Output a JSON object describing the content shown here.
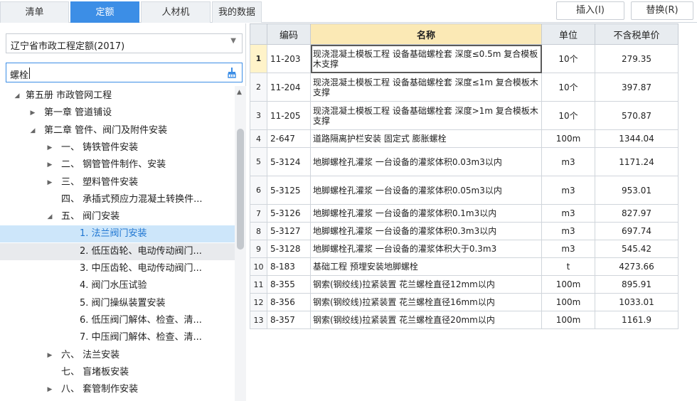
{
  "tabs": [
    "清单",
    "定额",
    "人材机",
    "我的数据"
  ],
  "active_tab": 1,
  "buttons": {
    "insert": "插入(I)",
    "replace": "替换(R)"
  },
  "library_select": {
    "value": "辽宁省市政工程定额(2017)"
  },
  "search": {
    "value": "螺栓"
  },
  "tree": [
    {
      "toggle": "◢",
      "label": "第五册 市政管网工程"
    },
    {
      "toggle": "▶",
      "label": "第一章 管道铺设"
    },
    {
      "toggle": "◢",
      "label": "第二章 管件、阀门及附件安装"
    },
    {
      "toggle": "▶",
      "label": "一、 铸铁管件安装"
    },
    {
      "toggle": "▶",
      "label": "二、 钢管管件制作、安装"
    },
    {
      "toggle": "▶",
      "label": "三、 塑料管件安装"
    },
    {
      "toggle": "",
      "label": "四、 承插式预应力混凝土转换件..."
    },
    {
      "toggle": "◢",
      "label": "五、 阀门安装"
    },
    {
      "toggle": "",
      "label": "1. 法兰阀门安装",
      "selected": true
    },
    {
      "toggle": "",
      "label": "2. 低压齿轮、电动传动阀门...",
      "hover": true
    },
    {
      "toggle": "",
      "label": "3. 中压齿轮、电动传动阀门..."
    },
    {
      "toggle": "",
      "label": "4. 阀门水压试验"
    },
    {
      "toggle": "",
      "label": "5. 阀门操纵装置安装"
    },
    {
      "toggle": "",
      "label": "6. 低压阀门解体、检查、清..."
    },
    {
      "toggle": "",
      "label": "7. 中压阀门解体、检查、清..."
    },
    {
      "toggle": "▶",
      "label": "六、 法兰安装"
    },
    {
      "toggle": "",
      "label": "七、 盲堵板安装"
    },
    {
      "toggle": "▶",
      "label": "八、 套管制作安装"
    }
  ],
  "table": {
    "columns": [
      "",
      "编码",
      "名称",
      "单位",
      "不含税单价"
    ],
    "rows": [
      {
        "no": "1",
        "code": "11-203",
        "name": "现浇混凝土模板工程 设备基础螺栓套 深度≤0.5m 复合模板木支撑",
        "unit": "10个",
        "price": "279.35"
      },
      {
        "no": "2",
        "code": "11-204",
        "name": "现浇混凝土模板工程 设备基础螺栓套 深度≤1m 复合模板木支撑",
        "unit": "10个",
        "price": "397.87"
      },
      {
        "no": "3",
        "code": "11-205",
        "name": "现浇混凝土模板工程 设备基础螺栓套 深度>1m 复合模板木支撑",
        "unit": "10个",
        "price": "570.87"
      },
      {
        "no": "4",
        "code": "2-647",
        "name": "道路隔离护栏安装 固定式 膨胀螺栓",
        "unit": "100m",
        "price": "1344.04"
      },
      {
        "no": "5",
        "code": "5-3124",
        "name": "地脚螺栓孔灌浆 一台设备的灌浆体积0.03m3以内",
        "unit": "m3",
        "price": "1171.24"
      },
      {
        "no": "6",
        "code": "5-3125",
        "name": "地脚螺栓孔灌浆 一台设备的灌浆体积0.05m3以内",
        "unit": "m3",
        "price": "953.01"
      },
      {
        "no": "7",
        "code": "5-3126",
        "name": "地脚螺栓孔灌浆 一台设备的灌浆体积0.1m3以内",
        "unit": "m3",
        "price": "827.97"
      },
      {
        "no": "8",
        "code": "5-3127",
        "name": "地脚螺栓孔灌浆 一台设备的灌浆体积0.3m3以内",
        "unit": "m3",
        "price": "697.74"
      },
      {
        "no": "9",
        "code": "5-3128",
        "name": "地脚螺栓孔灌浆 一台设备的灌浆体积大于0.3m3",
        "unit": "m3",
        "price": "545.42"
      },
      {
        "no": "10",
        "code": "8-183",
        "name": "基础工程 预埋安装地脚螺栓",
        "unit": "t",
        "price": "4273.66"
      },
      {
        "no": "11",
        "code": "8-355",
        "name": "钢索(钢绞线)拉紧装置 花兰螺栓直径12mm以内",
        "unit": "100m",
        "price": "895.91"
      },
      {
        "no": "12",
        "code": "8-356",
        "name": "钢索(钢绞线)拉紧装置 花兰螺栓直径16mm以内",
        "unit": "100m",
        "price": "1033.01"
      },
      {
        "no": "13",
        "code": "8-357",
        "name": "钢索(钢绞线)拉紧装置 花兰螺栓直径20mm以内",
        "unit": "100m",
        "price": "1161.9"
      }
    ]
  },
  "colors": {
    "accent": "#3c8ee6",
    "name_header": "#fbe9b5",
    "selected_row": "#cde6fa"
  }
}
